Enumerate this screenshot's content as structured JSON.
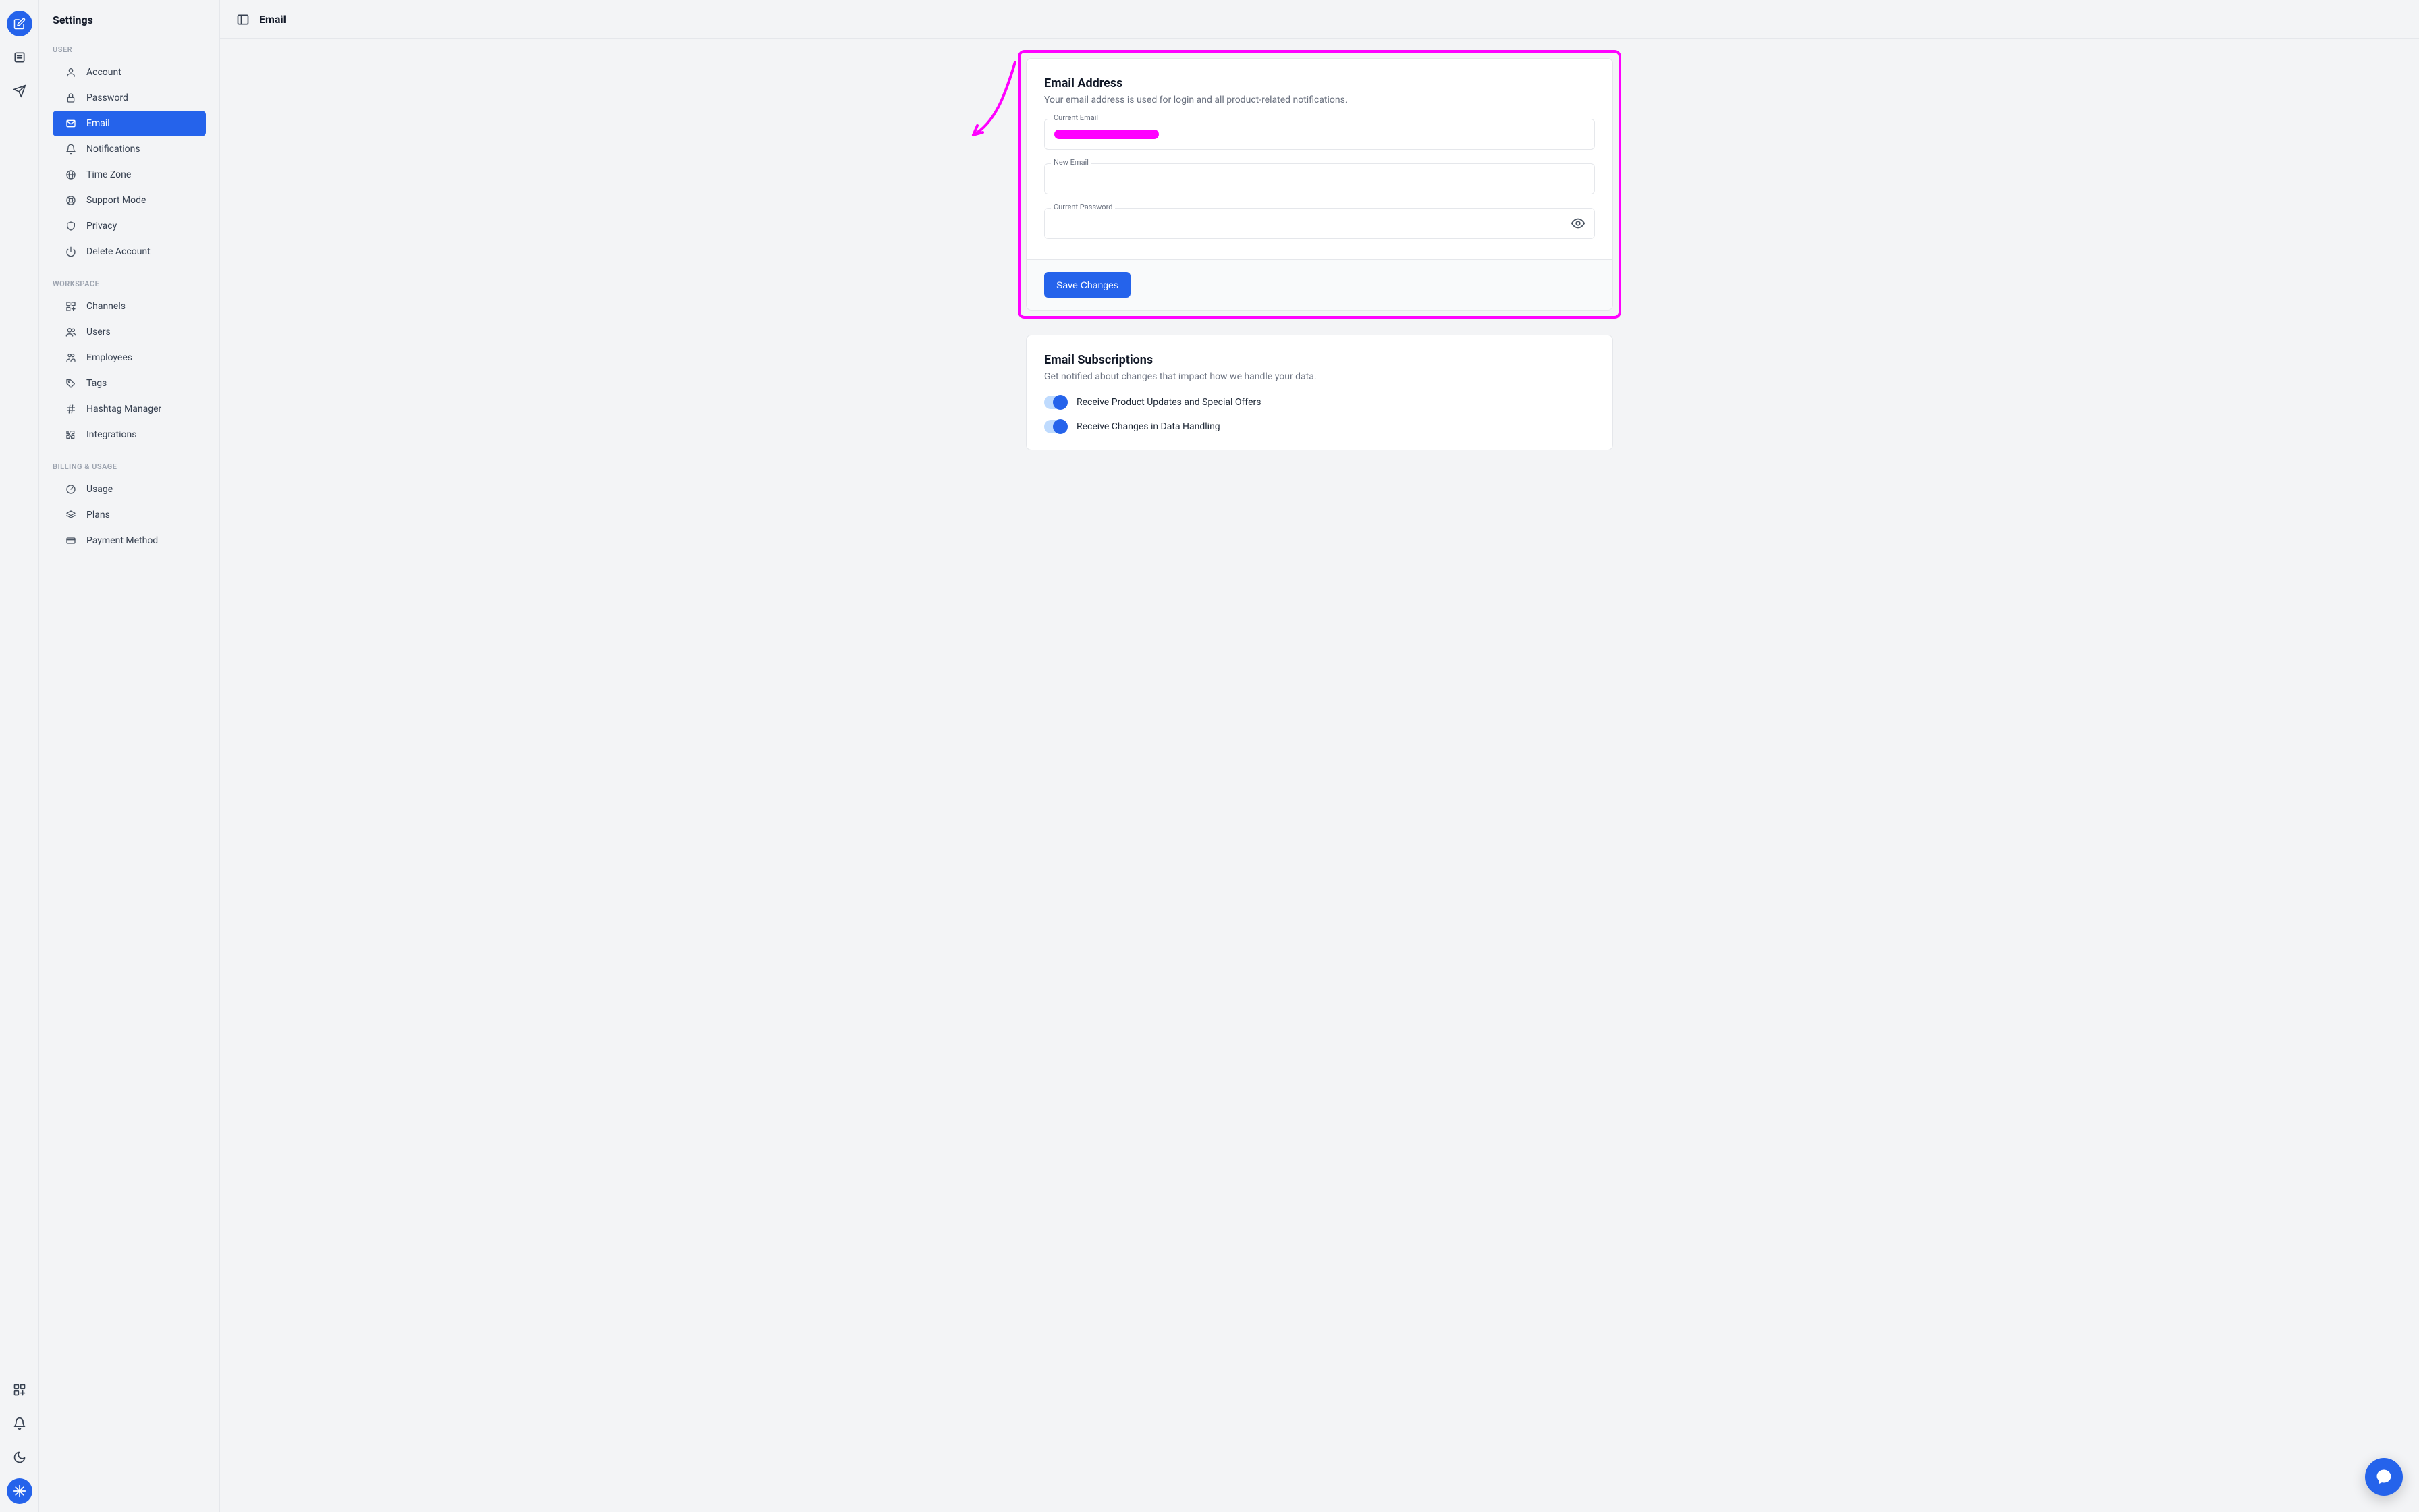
{
  "sidebar": {
    "title": "Settings",
    "groups": [
      {
        "label": "USER",
        "items": [
          {
            "id": "account",
            "label": "Account"
          },
          {
            "id": "password",
            "label": "Password"
          },
          {
            "id": "email",
            "label": "Email",
            "active": true
          },
          {
            "id": "notifications",
            "label": "Notifications"
          },
          {
            "id": "timezone",
            "label": "Time Zone"
          },
          {
            "id": "support",
            "label": "Support Mode"
          },
          {
            "id": "privacy",
            "label": "Privacy"
          },
          {
            "id": "delete",
            "label": "Delete Account"
          }
        ]
      },
      {
        "label": "WORKSPACE",
        "items": [
          {
            "id": "channels",
            "label": "Channels"
          },
          {
            "id": "users",
            "label": "Users"
          },
          {
            "id": "employees",
            "label": "Employees"
          },
          {
            "id": "tags",
            "label": "Tags"
          },
          {
            "id": "hashtag",
            "label": "Hashtag Manager"
          },
          {
            "id": "integrations",
            "label": "Integrations"
          }
        ]
      },
      {
        "label": "BILLING & USAGE",
        "items": [
          {
            "id": "usage",
            "label": "Usage"
          },
          {
            "id": "plans",
            "label": "Plans"
          },
          {
            "id": "payment",
            "label": "Payment Method"
          }
        ]
      }
    ]
  },
  "header": {
    "title": "Email"
  },
  "email_card": {
    "title": "Email Address",
    "description": "Your email address is used for login and all product-related notifications.",
    "fields": {
      "current_email_label": "Current Email",
      "current_email_value_redacted": true,
      "new_email_label": "New Email",
      "new_email_value": "",
      "current_password_label": "Current Password",
      "current_password_value": ""
    },
    "save_button": "Save Changes"
  },
  "subs_card": {
    "title": "Email Subscriptions",
    "description": "Get notified about changes that impact how we handle your data.",
    "toggles": [
      {
        "label": "Receive Product Updates and Special Offers",
        "on": true
      },
      {
        "label": "Receive Changes in Data Handling",
        "on": true
      }
    ]
  }
}
